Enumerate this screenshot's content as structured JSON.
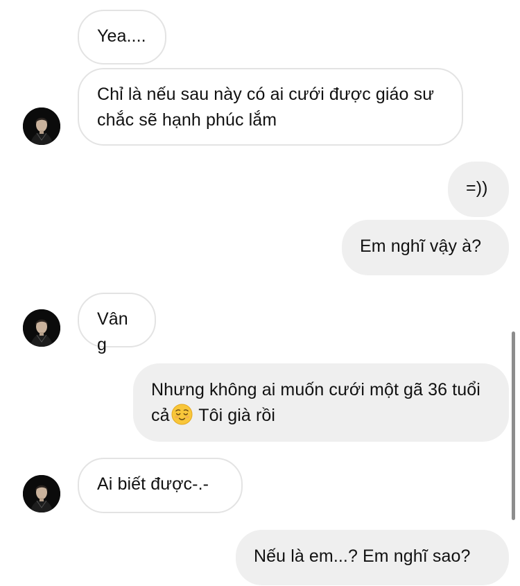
{
  "conversation": {
    "messages": [
      {
        "direction": "incoming",
        "text": "Yea...."
      },
      {
        "direction": "incoming",
        "text": "Chỉ là nếu sau này có ai cưới được giáo sư chắc sẽ hạnh phúc lắm"
      },
      {
        "direction": "outgoing",
        "text": "=))"
      },
      {
        "direction": "outgoing",
        "text": "Em nghĩ vậy à?"
      },
      {
        "direction": "incoming",
        "text": "Vâng"
      },
      {
        "direction": "outgoing",
        "text_before_emoji": "Nhưng không ai muốn cưới một gã 36 tuổi cả",
        "emoji": "relieved-face",
        "text_after_emoji": " Tôi già rồi"
      },
      {
        "direction": "incoming",
        "text": "Ai biết được-.-"
      },
      {
        "direction": "outgoing",
        "text": "Nếu là em...? Em nghĩ sao?"
      }
    ]
  },
  "colors": {
    "incoming_bubble_bg": "#ffffff",
    "incoming_bubble_border": "#e3e3e3",
    "outgoing_bubble_bg": "#efefef",
    "text": "#111111",
    "scrollbar": "#8d8d8d"
  },
  "icons": {
    "avatar": "profile-photo-avatar",
    "emoji": "relieved-face"
  }
}
